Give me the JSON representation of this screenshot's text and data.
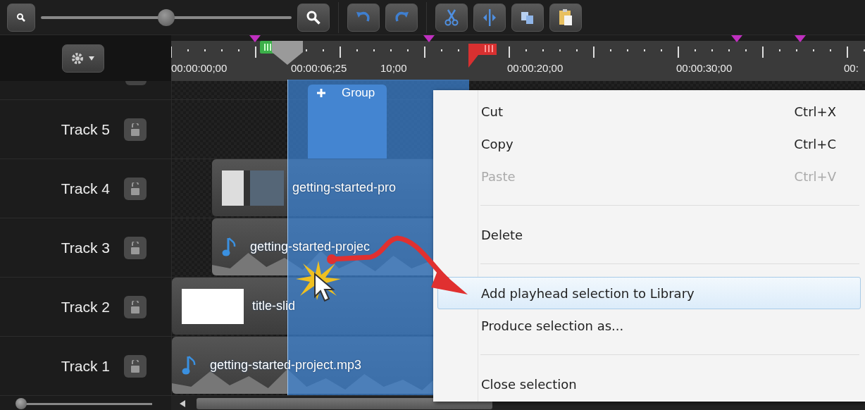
{
  "toolbar": {
    "zoom_slider": {
      "level": 0.5
    }
  },
  "ruler": {
    "labels": [
      "00:00:00;00",
      "00:00:06;25",
      "10;00",
      "00:00:20;00",
      "00:00:30;00",
      "00:"
    ]
  },
  "tracks": [
    {
      "name": "Track 5",
      "locked": false,
      "clips": [
        {
          "kind": "group",
          "label": "Group"
        }
      ]
    },
    {
      "name": "Track 4",
      "locked": false,
      "clips": [
        {
          "kind": "video",
          "label": "getting-started-pro"
        }
      ]
    },
    {
      "name": "Track 3",
      "locked": false,
      "clips": [
        {
          "kind": "audio",
          "label": "getting-started-projec"
        }
      ]
    },
    {
      "name": "Track 2",
      "locked": false,
      "clips": [
        {
          "kind": "image",
          "label": "title-slid"
        }
      ]
    },
    {
      "name": "Track 1",
      "locked": false,
      "clips": [
        {
          "kind": "audio",
          "label": "getting-started-project.mp3"
        }
      ]
    }
  ],
  "track_height_slider": {
    "level": 0
  },
  "context_menu": [
    {
      "kind": "item",
      "label": "Cut",
      "shortcut": "Ctrl+X",
      "disabled": false,
      "selected": false
    },
    {
      "kind": "item",
      "label": "Copy",
      "shortcut": "Ctrl+C",
      "disabled": false,
      "selected": false
    },
    {
      "kind": "item",
      "label": "Paste",
      "shortcut": "Ctrl+V",
      "disabled": true,
      "selected": false
    },
    {
      "kind": "separator"
    },
    {
      "kind": "item",
      "label": "Delete",
      "disabled": false,
      "selected": false
    },
    {
      "kind": "separator"
    },
    {
      "kind": "item",
      "label": "Add playhead selection to Library",
      "disabled": false,
      "selected": true
    },
    {
      "kind": "item",
      "label": "Produce selection as...",
      "disabled": false,
      "selected": false
    },
    {
      "kind": "separator"
    },
    {
      "kind": "item",
      "label": "Close selection",
      "disabled": false,
      "selected": false
    }
  ]
}
